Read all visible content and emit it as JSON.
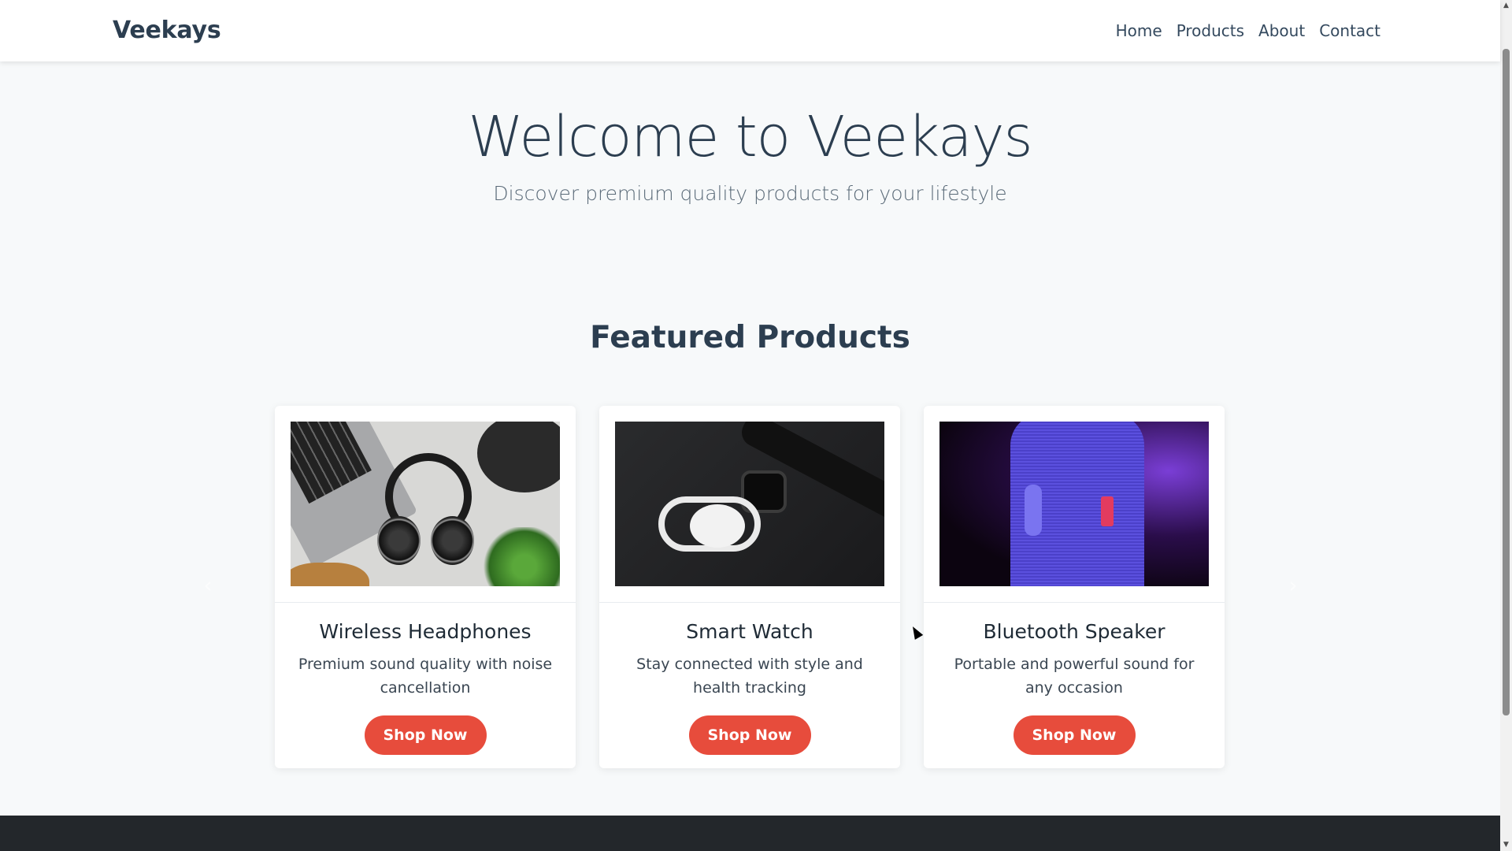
{
  "navbar": {
    "brand": "Veekays",
    "links": [
      "Home",
      "Products",
      "About",
      "Contact"
    ]
  },
  "hero": {
    "title": "Welcome to Veekays",
    "subtitle": "Discover premium quality products for your lifestyle"
  },
  "featured": {
    "title": "Featured Products",
    "carousel": {
      "prev_icon": "chevron-left-icon",
      "next_icon": "chevron-right-icon"
    },
    "products": [
      {
        "name": "Wireless Headphones",
        "description": "Premium sound quality with noise cancellation",
        "button": "Shop Now"
      },
      {
        "name": "Smart Watch",
        "description": "Stay connected with style and health tracking",
        "button": "Shop Now"
      },
      {
        "name": "Bluetooth Speaker",
        "description": "Portable and powerful sound for any occasion",
        "button": "Shop Now"
      }
    ]
  },
  "colors": {
    "accent": "#e74c3c",
    "text": "#2c3e50",
    "background": "#f7f9fa",
    "footer": "#23272b"
  }
}
